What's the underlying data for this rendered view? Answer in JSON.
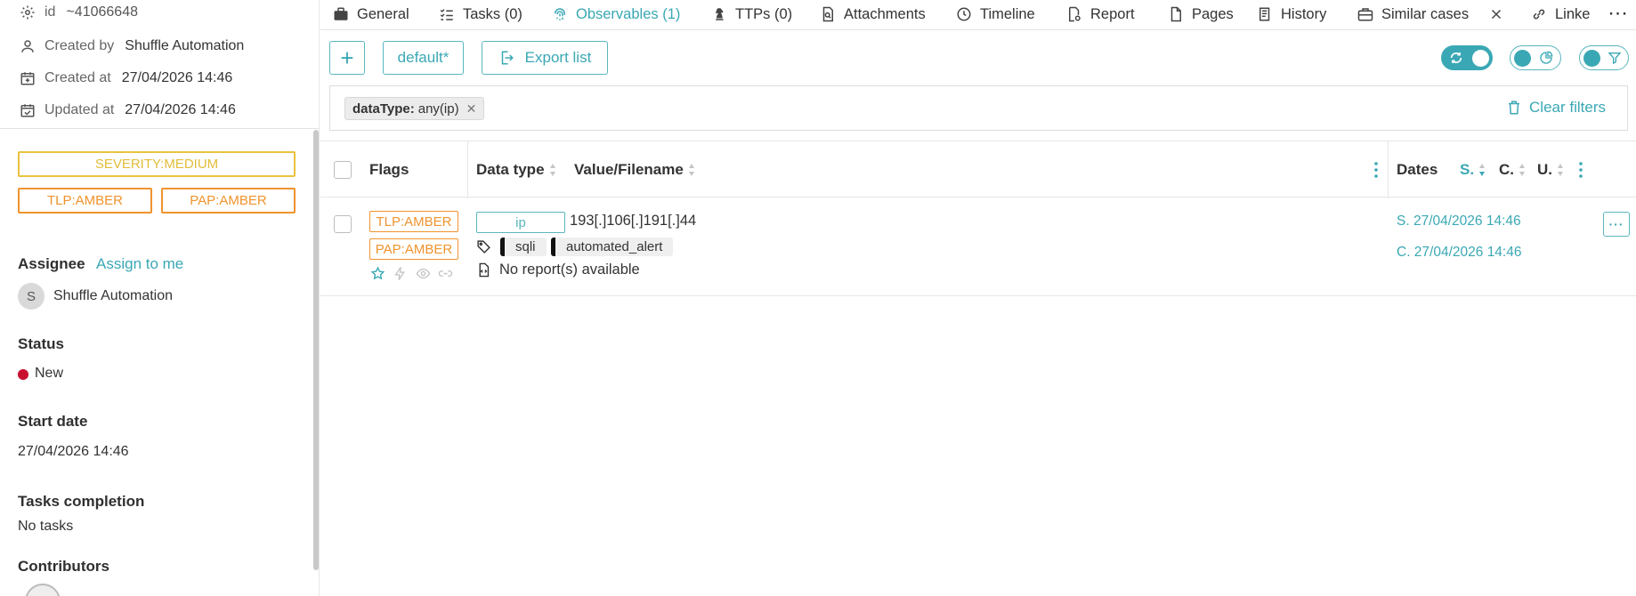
{
  "left_panel": {
    "id_label": "id",
    "id_value": "~41066648",
    "created_by_label": "Created by",
    "created_by_value": "Shuffle Automation",
    "created_at_label": "Created at",
    "created_at_value": "27/04/2026 14:46",
    "updated_at_label": "Updated at",
    "updated_at_value": "27/04/2026 14:46",
    "severity": "SEVERITY:MEDIUM",
    "tlp": "TLP:AMBER",
    "pap": "PAP:AMBER",
    "assignee_title": "Assignee",
    "assign_link": "Assign to me",
    "assignee_initial": "S",
    "assignee_name": "Shuffle Automation",
    "status_title": "Status",
    "status_value": "New",
    "start_date_title": "Start date",
    "start_date_value": "27/04/2026 14:46",
    "tasks_title": "Tasks completion",
    "tasks_value": "No tasks",
    "contributors_title": "Contributors"
  },
  "tabs": [
    {
      "label": "General",
      "icon": "briefcase-icon"
    },
    {
      "label": "Tasks (0)",
      "icon": "checklist-icon"
    },
    {
      "label": "Observables (1)",
      "icon": "fingerprint-icon",
      "active": true
    },
    {
      "label": "TTPs (0)",
      "icon": "chess-knight-icon"
    },
    {
      "label": "Attachments",
      "icon": "file-search-icon"
    },
    {
      "label": "Timeline",
      "icon": "clock-icon"
    },
    {
      "label": "Report",
      "icon": "file-gear-icon"
    },
    {
      "label": "Pages",
      "icon": "page-icon"
    },
    {
      "label": "History",
      "icon": "book-icon"
    },
    {
      "label": "Similar cases",
      "icon": "briefcase-outline-icon"
    },
    {
      "label": "Linke",
      "icon": "link-icon"
    }
  ],
  "toolbar": {
    "add_label": "+",
    "preset_label": "default*",
    "export_label": "Export list"
  },
  "filters": {
    "chip_key": "dataType:",
    "chip_value": "any(ip)",
    "clear_label": "Clear filters"
  },
  "table": {
    "headers": {
      "flags": "Flags",
      "data_type": "Data type",
      "value": "Value/Filename",
      "dates": "Dates",
      "s": "S.",
      "c": "C.",
      "u": "U."
    },
    "rows": [
      {
        "tlp": "TLP:AMBER",
        "pap": "PAP:AMBER",
        "data_type": "ip",
        "value": "193[.]106[.]191[.]44",
        "tags": [
          "sqli",
          "automated_alert"
        ],
        "report": "No report(s) available",
        "date_s": "S. 27/04/2026 14:46",
        "date_c": "C. 27/04/2026 14:46"
      }
    ]
  },
  "colors": {
    "accent": "#3aa8b4",
    "amber": "#f0932e",
    "severity_medium": "#e2bd3a",
    "status_new": "#c8102e"
  }
}
